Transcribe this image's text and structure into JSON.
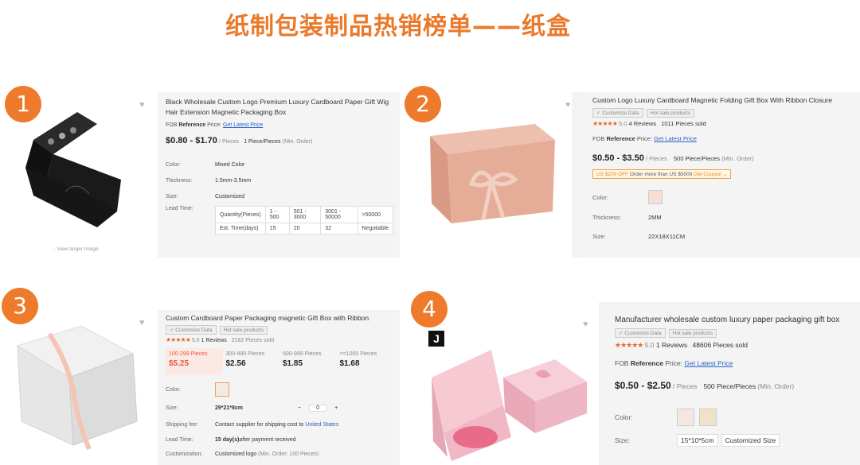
{
  "page_title": "纸制包装制品热销榜单——纸盒",
  "products": [
    {
      "rank": "1",
      "title": "Black Wholesale Custom Logo Premium Luxury Cardboard Paper Gift Wig Hair Extension Magnetic Packaging Box",
      "fob_prefix": "FOB ",
      "fob_bold": "Reference",
      "fob_suffix": " Price: ",
      "fob_link": "Get Latest Price",
      "price_range": "$0.80 - $1.70",
      "price_unit": "/ Pieces",
      "moq": "1 Piece/Pieces",
      "moq_note": "(Min. Order)",
      "view_larger": "View larger image",
      "attrs": [
        {
          "label": "Color:",
          "value": "Mixed Color"
        },
        {
          "label": "Thickness:",
          "value": "1.5mm-3.5mm"
        },
        {
          "label": "Size:",
          "value": "Customized"
        }
      ],
      "lead_time_label": "Lead Time:",
      "lead_time_table": {
        "row1": [
          "Quantity(Pieces)",
          "1 - 500",
          "501 - 3000",
          "3001 - 50000",
          ">50000"
        ],
        "row2": [
          "Est. Time(days)",
          "15",
          "20",
          "32",
          "Negotiable"
        ]
      },
      "colors": {
        "box": "#1c1c1c"
      }
    },
    {
      "rank": "2",
      "title": "Custom Logo Luxury Cardboard Magnetic Folding Gift Box With Ribbon Closure",
      "tags": [
        "Customize Data",
        "Hot sale products"
      ],
      "rating": "5.0",
      "stars": "★★★★★",
      "reviews": "4 Reviews",
      "sold": "1011 Pieces sold",
      "fob_prefix": "FOB ",
      "fob_bold": "Reference",
      "fob_suffix": " Price: ",
      "fob_link": "Get Latest Price",
      "price_range": "$0.50 - $3.50",
      "price_unit": "/ Pieces",
      "moq": "500 Piece/Pieces",
      "moq_note": "(Min. Order)",
      "coupon": "US $200 OFF",
      "coupon_text": "Order more than US $5000",
      "coupon_btn": "Get Coupon",
      "attrs": [
        {
          "label": "Color:",
          "value": ""
        },
        {
          "label": "Thickness:",
          "value": "2MM"
        },
        {
          "label": "Size:",
          "value": "22X18X11CM"
        }
      ],
      "colors": {
        "box": "#e3aa96"
      }
    },
    {
      "rank": "3",
      "title": "Custom Cardboard Paper Packaging magnetic Gift Box with Ribbon",
      "tags": [
        "Customize Data",
        "Hot sale products"
      ],
      "rating": "5.0",
      "stars": "★★★★★",
      "reviews": "1 Reviews",
      "sold": "2162 Pieces sold",
      "tiers": [
        {
          "qty": "100-299 Pieces",
          "price": "$5.25"
        },
        {
          "qty": "300-499 Pieces",
          "price": "$2.56"
        },
        {
          "qty": "500-999 Pieces",
          "price": "$1.85"
        },
        {
          "qty": ">=1000 Pieces",
          "price": "$1.68"
        }
      ],
      "color_label": "Color:",
      "size_label": "Size:",
      "size_value": "29*21*8cm",
      "qty_value": "0",
      "shipping_label": "Shipping fee:",
      "shipping_text": "Contact supplier for shipping cost to ",
      "shipping_dest": "United States",
      "lead_label": "Lead Time:",
      "lead_bold": "15 day(s)",
      "lead_text": " after payment received",
      "custom_label": "Customization:",
      "custom_text": "Customized logo ",
      "custom_note": "(Min. Order: 100 Pieces)",
      "colors": {
        "box": "#eeeeee",
        "ribbon": "#f0c0b0"
      }
    },
    {
      "rank": "4",
      "title": "Manufacturer wholesale custom luxury paper packaging gift box",
      "brand_mark": "J",
      "tags": [
        "Customize Data",
        "Hot sale products"
      ],
      "rating": "5.0",
      "stars": "★★★★★",
      "reviews": "1 Reviews",
      "sold": "48606 Pieces sold",
      "fob_prefix": "FOB ",
      "fob_bold": "Reference",
      "fob_suffix": " Price: ",
      "fob_link": "Get Latest Price",
      "price_range": "$0.50 - $2.50",
      "price_unit": "/ Pieces",
      "moq": "500 Piece/Pieces",
      "moq_note": "(Min. Order)",
      "color_label": "Color:",
      "size_label": "Size:",
      "sizes": [
        "15*10*5cm",
        "Customized Size"
      ],
      "colors": {
        "box": "#f2b9c6"
      }
    }
  ]
}
